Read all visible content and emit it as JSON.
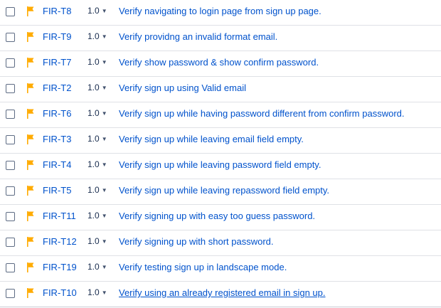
{
  "colors": {
    "link": "#0052cc",
    "flag": "#ffab00",
    "divider": "#dfe1e6",
    "checkbox_border": "#5e6c84"
  },
  "icons": {
    "checkbox": "checkbox-icon",
    "flag": "flag-icon",
    "version_dropdown": "chevron-down-icon"
  },
  "rows": [
    {
      "key": "FIR-T8",
      "version": "1.0",
      "title": "Verify navigating to login page from sign up page."
    },
    {
      "key": "FIR-T9",
      "version": "1.0",
      "title": "Verify providng an invalid format email."
    },
    {
      "key": "FIR-T7",
      "version": "1.0",
      "title": "Verify show password & show confirm password."
    },
    {
      "key": "FIR-T2",
      "version": "1.0",
      "title": "Verify sign up using Valid email"
    },
    {
      "key": "FIR-T6",
      "version": "1.0",
      "title": "Verify sign up while having password different from confirm password."
    },
    {
      "key": "FIR-T3",
      "version": "1.0",
      "title": "Verify sign up while leaving email field empty."
    },
    {
      "key": "FIR-T4",
      "version": "1.0",
      "title": "Verify sign up while leaving password field empty."
    },
    {
      "key": "FIR-T5",
      "version": "1.0",
      "title": "Verify sign up while leaving repassword field empty."
    },
    {
      "key": "FIR-T11",
      "version": "1.0",
      "title": "Verify signing up with easy too guess password."
    },
    {
      "key": "FIR-T12",
      "version": "1.0",
      "title": "Verify signing up with short password."
    },
    {
      "key": "FIR-T19",
      "version": "1.0",
      "title": "Verify testing sign up in landscape mode."
    },
    {
      "key": "FIR-T10",
      "version": "1.0",
      "title": "Verify using an already registered email in sign up.",
      "hovered": true
    }
  ]
}
